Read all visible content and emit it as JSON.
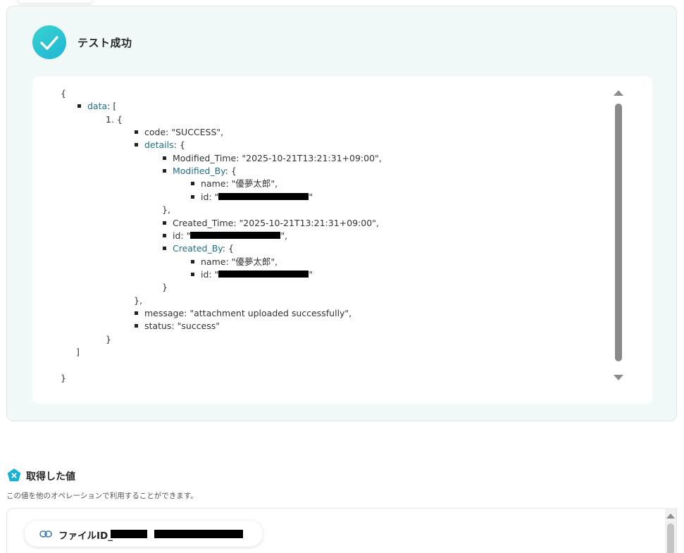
{
  "result": {
    "title": "テスト成功",
    "json_lines": [
      {
        "text": "{",
        "indent": 0,
        "bullet": false
      },
      {
        "key": "data",
        "rest": ": [",
        "indent": 1,
        "bullet": true,
        "link": true
      },
      {
        "text": "1. {",
        "indent": 2,
        "bullet": false
      },
      {
        "key": "code",
        "rest": ": \"SUCCESS\",",
        "indent": 3,
        "bullet": true,
        "link": false
      },
      {
        "key": "details",
        "rest": ": {",
        "indent": 3,
        "bullet": true,
        "link": true
      },
      {
        "key": "Modified_Time",
        "rest": ": \"2025-10-21T13:21:31+09:00\",",
        "indent": 4,
        "bullet": true,
        "link": false
      },
      {
        "key": "Modified_By",
        "rest": ": {",
        "indent": 4,
        "bullet": true,
        "link": true
      },
      {
        "key": "name",
        "rest": ": \"優夢太郎\",",
        "indent": 5,
        "bullet": true,
        "link": false
      },
      {
        "key": "id",
        "rest": ": \"",
        "redact": 128,
        "after": "\"",
        "indent": 5,
        "bullet": true,
        "link": false
      },
      {
        "text": "},",
        "indent": 4,
        "bullet": false
      },
      {
        "key": "Created_Time",
        "rest": ": \"2025-10-21T13:21:31+09:00\",",
        "indent": 4,
        "bullet": true,
        "link": false
      },
      {
        "key": "id",
        "rest": ": \"",
        "redact": 128,
        "after": "\",",
        "indent": 4,
        "bullet": true,
        "link": false
      },
      {
        "key": "Created_By",
        "rest": ": {",
        "indent": 4,
        "bullet": true,
        "link": true
      },
      {
        "key": "name",
        "rest": ": \"優夢太郎\",",
        "indent": 5,
        "bullet": true,
        "link": false
      },
      {
        "key": "id",
        "rest": ": \"",
        "redact": 128,
        "after": "\"",
        "indent": 5,
        "bullet": true,
        "link": false
      },
      {
        "text": "}",
        "indent": 4,
        "bullet": false
      },
      {
        "text": "},",
        "indent": 3,
        "bullet": false
      },
      {
        "key": "message",
        "rest": ": \"attachment uploaded successfully\",",
        "indent": 3,
        "bullet": true,
        "link": false
      },
      {
        "key": "status",
        "rest": ": \"success\"",
        "indent": 3,
        "bullet": true,
        "link": false
      },
      {
        "text": "}",
        "indent": 2,
        "bullet": false
      },
      {
        "text": "]",
        "indent": 1,
        "bullet": false
      },
      {
        "text": "",
        "indent": 0,
        "bullet": false
      },
      {
        "text": "}",
        "indent": 0,
        "bullet": false
      }
    ]
  },
  "values": {
    "title": "取得した値",
    "description": "この値を他のオペレーションで利用することができます。",
    "chip_label": "ファイルID_"
  },
  "icons": {
    "success": "check-icon",
    "values": "x-badge-icon",
    "chip": "link-icon"
  },
  "colors": {
    "success_gradient_start": "#39d3cf",
    "success_gradient_end": "#1fb5d6",
    "panel_bg": "#f1faf9",
    "json_key_link": "#1f6f86"
  }
}
